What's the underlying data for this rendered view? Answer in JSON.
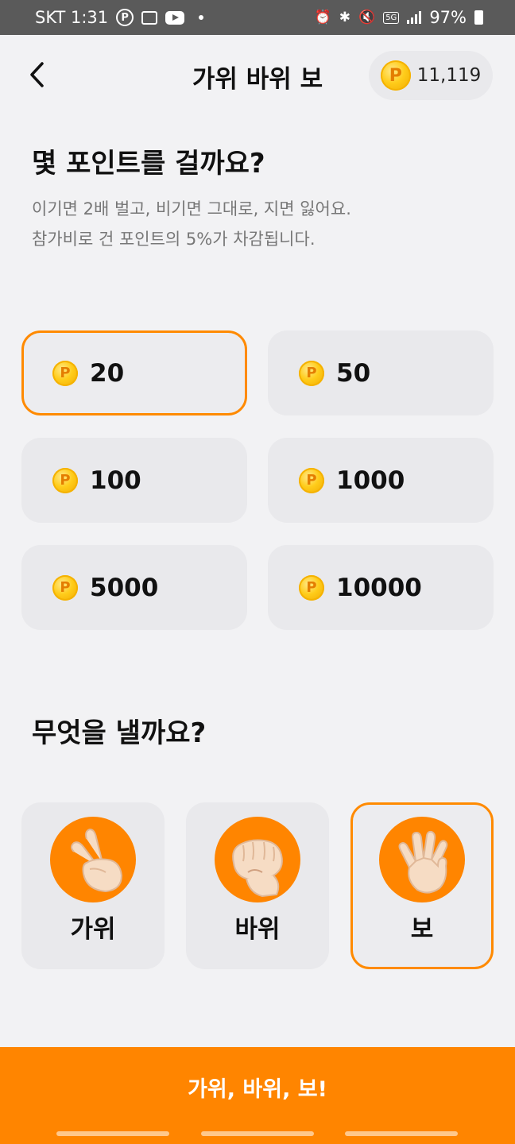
{
  "status_bar": {
    "carrier_time": "SKT 1:31",
    "net": "5G",
    "battery": "97%"
  },
  "header": {
    "title": "가위 바위 보",
    "balance": "11,119",
    "coin_letter": "P"
  },
  "bet": {
    "question": "몇 포인트를 걸까요?",
    "desc_line1": "이기면 2배 벌고, 비기면 그대로, 지면 잃어요.",
    "desc_line2": "참가비로 건 포인트의 5%가 차감됩니다.",
    "options": [
      {
        "amount": "20",
        "selected": true
      },
      {
        "amount": "50",
        "selected": false
      },
      {
        "amount": "100",
        "selected": false
      },
      {
        "amount": "1000",
        "selected": false
      },
      {
        "amount": "5000",
        "selected": false
      },
      {
        "amount": "10000",
        "selected": false
      }
    ]
  },
  "choice": {
    "question": "무엇을 낼까요?",
    "options": [
      {
        "label": "가위",
        "icon": "scissors-hand-icon",
        "selected": false
      },
      {
        "label": "바위",
        "icon": "rock-fist-icon",
        "selected": false
      },
      {
        "label": "보",
        "icon": "paper-hand-icon",
        "selected": true
      }
    ]
  },
  "cta": {
    "label": "가위, 바위, 보!"
  },
  "colors": {
    "accent": "#ff8500",
    "coin": "#ffcc1a",
    "card_bg": "#e9e9ec",
    "page_bg": "#f2f2f4"
  }
}
